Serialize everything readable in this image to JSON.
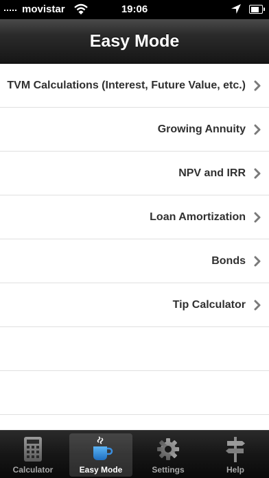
{
  "status_bar": {
    "carrier": "movistar",
    "time": "19:06",
    "battery_level": 0.85
  },
  "nav": {
    "title": "Easy Mode"
  },
  "menu": [
    {
      "label": "TVM Calculations (Interest, Future Value, etc.)"
    },
    {
      "label": "Growing Annuity"
    },
    {
      "label": "NPV and IRR"
    },
    {
      "label": "Loan Amortization"
    },
    {
      "label": "Bonds"
    },
    {
      "label": "Tip Calculator"
    }
  ],
  "tabs": [
    {
      "label": "Calculator",
      "icon": "calculator-icon",
      "selected": false
    },
    {
      "label": "Easy Mode",
      "icon": "coffee-cup-icon",
      "selected": true
    },
    {
      "label": "Settings",
      "icon": "gear-icon",
      "selected": false
    },
    {
      "label": "Help",
      "icon": "signpost-icon",
      "selected": false
    }
  ],
  "colors": {
    "accent_blue": "#2f8fdf",
    "list_text": "#303030",
    "chevron": "#7a7a7a"
  }
}
